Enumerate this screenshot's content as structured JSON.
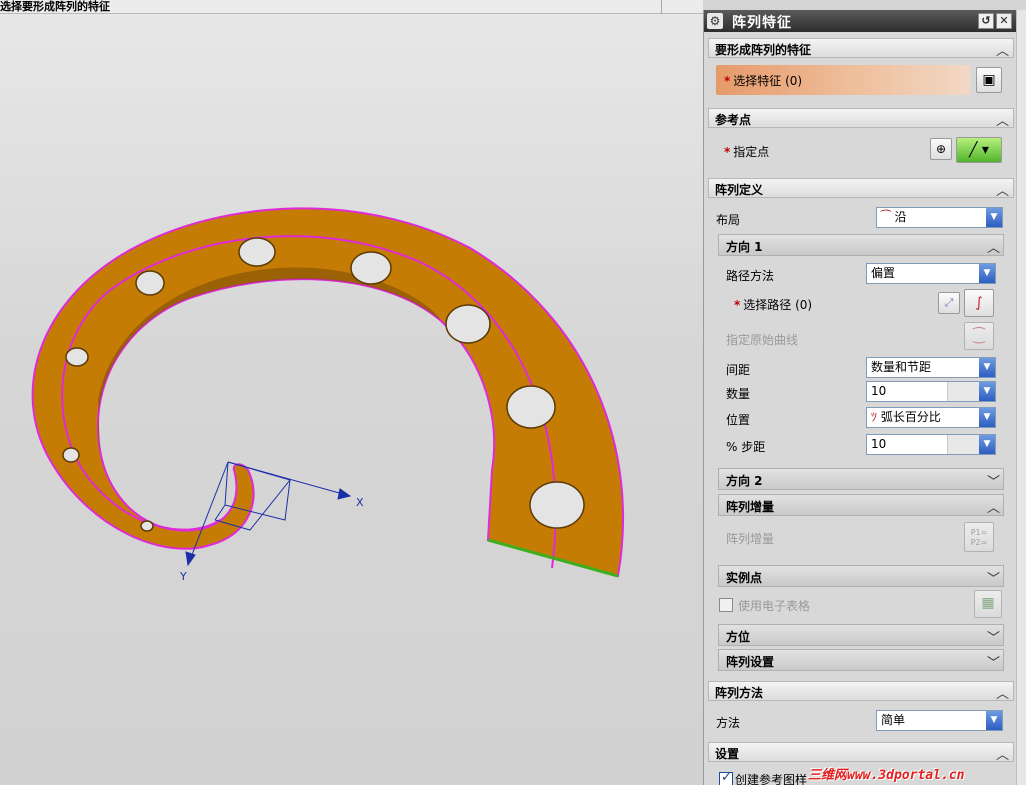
{
  "cue_line": "选择要形成阵列的特征",
  "dialog": {
    "title": "阵列特征",
    "sections": {
      "features": {
        "label": "要形成阵列的特征",
        "select_label": "选择特征 (0)"
      },
      "reference_point": {
        "label": "参考点",
        "specify_point": "指定点"
      },
      "array_definition": {
        "label": "阵列定义",
        "layout_label": "布局",
        "layout_value": "沿",
        "direction1": {
          "label": "方向 1",
          "path_method_label": "路径方法",
          "path_method_value": "偏置",
          "select_path": "选择路径 (0)",
          "specify_curve": "指定原始曲线",
          "spacing_label": "间距",
          "spacing_value": "数量和节距",
          "count_label": "数量",
          "count_value": "10",
          "position_label": "位置",
          "position_value": "弧长百分比",
          "step_label": "% 步距",
          "step_value": "10"
        },
        "direction2": {
          "label": "方向 2"
        },
        "increment": {
          "label": "阵列增量",
          "item": "阵列增量",
          "icon_text": "P1=\nP2="
        },
        "instance_points": {
          "label": "实例点",
          "spreadsheet": "使用电子表格"
        },
        "orientation": {
          "label": "方位"
        },
        "array_settings": {
          "label": "阵列设置"
        }
      },
      "array_method": {
        "label": "阵列方法",
        "method_label": "方法",
        "method_value": "简单"
      },
      "settings": {
        "label": "设置",
        "create_reference": "创建参考图样",
        "create_reference_checked": true
      }
    }
  },
  "watermark": {
    "cn": "三维网",
    "url": "www.3dportal.cn"
  },
  "axes": {
    "x": "X",
    "y": "Y"
  },
  "colors": {
    "part_fill": "#c47c05",
    "part_edge": "#e02ad8",
    "accent_blue": "#2c5ec2",
    "selection_orange": "#e69a6a"
  }
}
